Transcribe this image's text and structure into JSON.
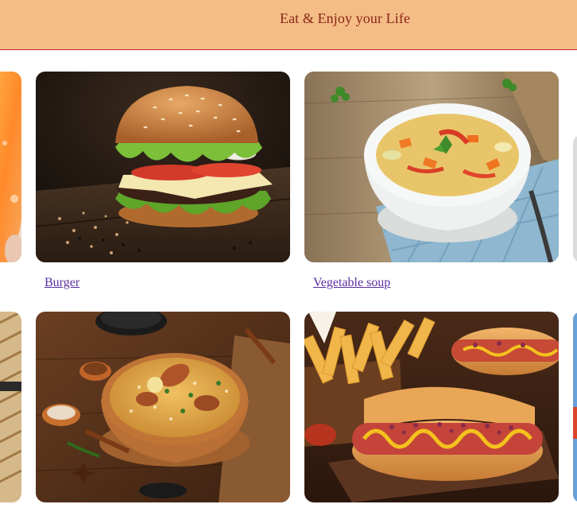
{
  "header": {
    "title": "Eat & Enjoy your Life"
  },
  "gallery": {
    "row1": [
      {
        "label": "",
        "image": "orange-dessert-image"
      },
      {
        "label": "Burger",
        "image": "burger-image"
      },
      {
        "label": "Vegetable soup",
        "image": "vegetable-soup-image"
      }
    ],
    "row2": [
      {
        "label": "",
        "image": "bamboo-skewers-image"
      },
      {
        "label": "",
        "image": "chicken-biryani-image"
      },
      {
        "label": "",
        "image": "hot-dog-fries-image"
      }
    ]
  },
  "colors": {
    "header_bg": "#f4bd86",
    "header_border": "#c8202a",
    "header_text": "#8a2418",
    "link": "#5a2fa0"
  }
}
